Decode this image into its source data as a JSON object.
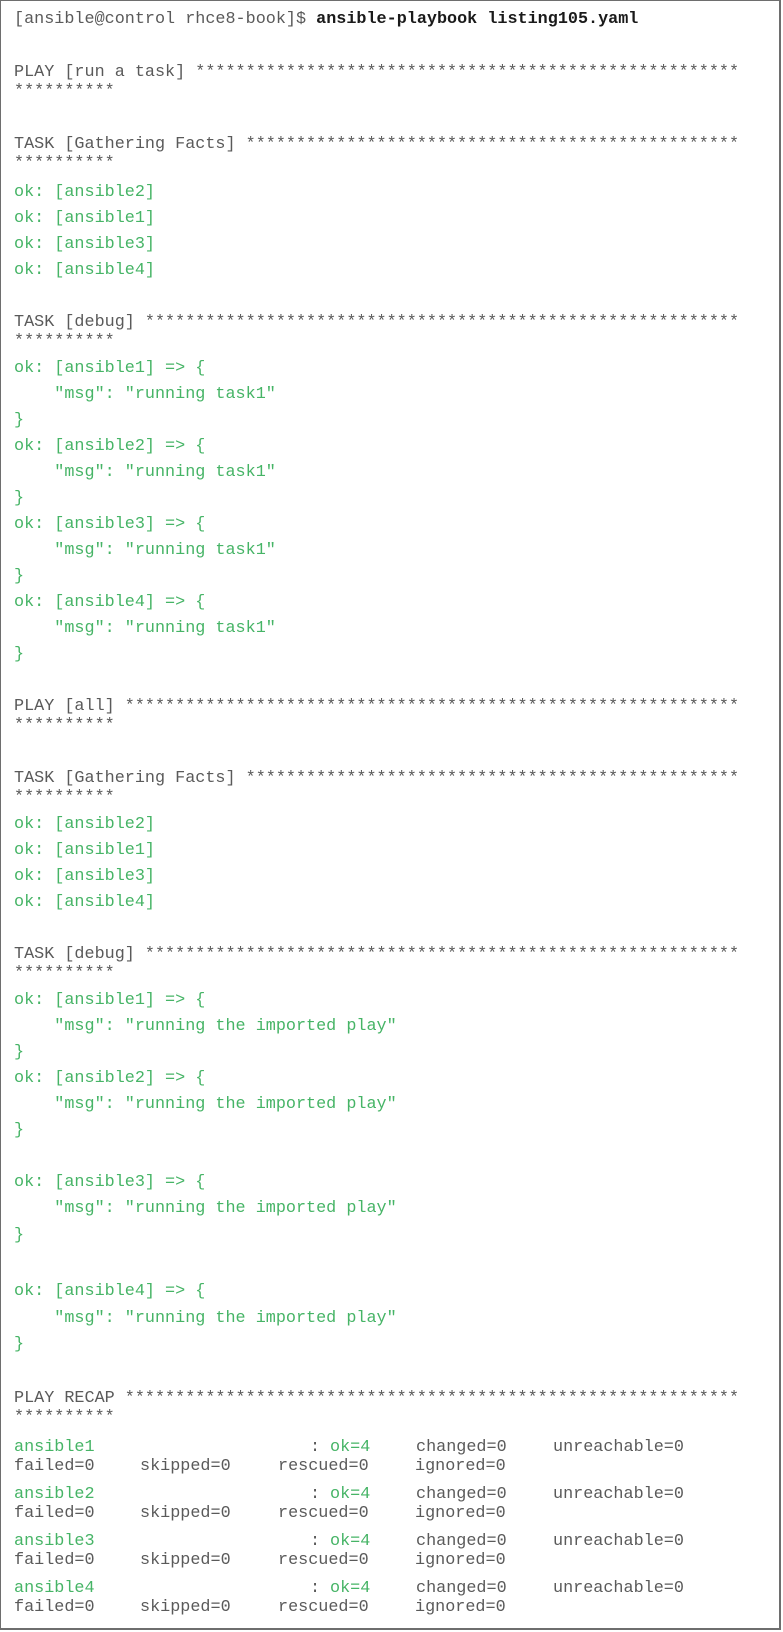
{
  "colors": {
    "ok": "#46b466",
    "text": "#5a5a5a",
    "command": "#1a1a1a",
    "border": "#6e6e6e"
  },
  "prompt": {
    "user_host_dir": "[ansible@control rhce8-book]$ ",
    "command": "ansible-playbook listing105.yaml"
  },
  "star_tail": "**********",
  "lines": [
    {
      "type": "header",
      "text": "PLAY [run a task] ******************************************************"
    },
    {
      "type": "header",
      "text": "TASK [Gathering Facts] *************************************************"
    },
    {
      "type": "ok",
      "text": "ok: [ansible2]"
    },
    {
      "type": "ok",
      "text": "ok: [ansible1]"
    },
    {
      "type": "ok",
      "text": "ok: [ansible3]"
    },
    {
      "type": "ok",
      "text": "ok: [ansible4]"
    },
    {
      "type": "header",
      "text": "TASK [debug] ***********************************************************"
    },
    {
      "type": "ok",
      "text": "ok: [ansible1] => {"
    },
    {
      "type": "ok",
      "text": "    \"msg\": \"running task1\""
    },
    {
      "type": "ok",
      "text": "}"
    },
    {
      "type": "ok",
      "text": "ok: [ansible2] => {"
    },
    {
      "type": "ok",
      "text": "    \"msg\": \"running task1\""
    },
    {
      "type": "ok",
      "text": "}"
    },
    {
      "type": "ok",
      "text": "ok: [ansible3] => {"
    },
    {
      "type": "ok",
      "text": "    \"msg\": \"running task1\""
    },
    {
      "type": "ok",
      "text": "}"
    },
    {
      "type": "ok",
      "text": "ok: [ansible4] => {"
    },
    {
      "type": "ok",
      "text": "    \"msg\": \"running task1\""
    },
    {
      "type": "ok",
      "text": "}"
    },
    {
      "type": "header",
      "text": "PLAY [all] *************************************************************"
    },
    {
      "type": "header",
      "text": "TASK [Gathering Facts] *************************************************"
    },
    {
      "type": "ok",
      "text": "ok: [ansible2]"
    },
    {
      "type": "ok",
      "text": "ok: [ansible1]"
    },
    {
      "type": "ok",
      "text": "ok: [ansible3]"
    },
    {
      "type": "ok",
      "text": "ok: [ansible4]"
    },
    {
      "type": "header",
      "text": "TASK [debug] ***********************************************************"
    },
    {
      "type": "ok",
      "text": "ok: [ansible1] => {"
    },
    {
      "type": "ok",
      "text": "    \"msg\": \"running the imported play\""
    },
    {
      "type": "ok",
      "text": "}"
    },
    {
      "type": "ok",
      "text": "ok: [ansible2] => {"
    },
    {
      "type": "ok",
      "text": "    \"msg\": \"running the imported play\""
    },
    {
      "type": "ok",
      "text": "}"
    },
    {
      "type": "ok",
      "text": "ok: [ansible3] => {"
    },
    {
      "type": "ok",
      "text": "    \"msg\": \"running the imported play\""
    },
    {
      "type": "ok",
      "text": "}"
    },
    {
      "type": "ok",
      "text": "ok: [ansible4] => {"
    },
    {
      "type": "ok",
      "text": "    \"msg\": \"running the imported play\""
    },
    {
      "type": "ok",
      "text": "}"
    },
    {
      "type": "header",
      "text": "PLAY RECAP *************************************************************"
    }
  ],
  "recap": [
    {
      "host": "ansible1",
      "sep": ":",
      "ok": "ok=4",
      "changed": "changed=0",
      "unreachable": "unreachable=0",
      "failed": "failed=0",
      "skipped": "skipped=0",
      "rescued": "rescued=0",
      "ignored": "ignored=0"
    },
    {
      "host": "ansible2",
      "sep": ":",
      "ok": "ok=4",
      "changed": "changed=0",
      "unreachable": "unreachable=0",
      "failed": "failed=0",
      "skipped": "skipped=0",
      "rescued": "rescued=0",
      "ignored": "ignored=0"
    },
    {
      "host": "ansible3",
      "sep": ":",
      "ok": "ok=4",
      "changed": "changed=0",
      "unreachable": "unreachable=0",
      "failed": "failed=0",
      "skipped": "skipped=0",
      "rescued": "rescued=0",
      "ignored": "ignored=0"
    },
    {
      "host": "ansible4",
      "sep": ":",
      "ok": "ok=4",
      "changed": "changed=0",
      "unreachable": "unreachable=0",
      "failed": "failed=0",
      "skipped": "skipped=0",
      "rescued": "rescued=0",
      "ignored": "ignored=0"
    }
  ]
}
